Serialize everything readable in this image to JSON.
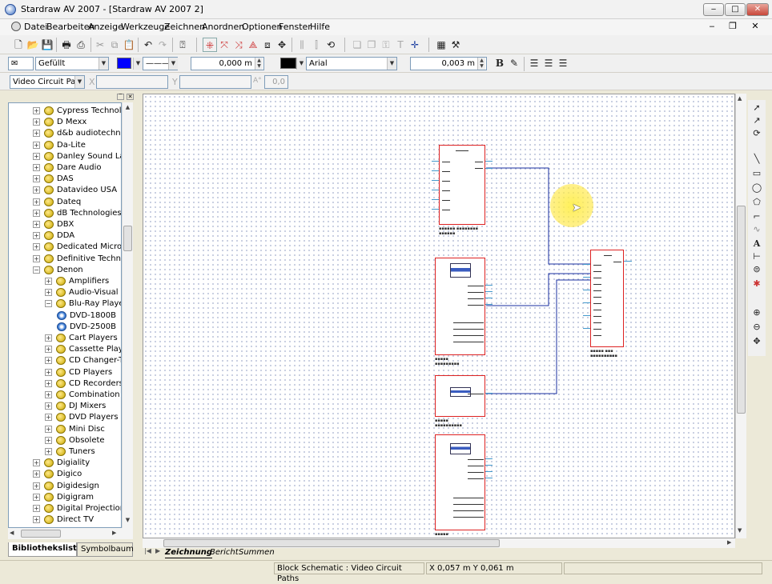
{
  "window": {
    "title": "Stardraw AV 2007 - [Stardraw AV 2007 2]",
    "min_label": "‒",
    "max_label": "□",
    "close_label": "✕"
  },
  "menu": [
    "Datei",
    "Bearbeiten",
    "Anzeige",
    "Werkzeuge",
    "Zeichnen",
    "Anordnen",
    "Optionen",
    "Fenster",
    "Hilfe"
  ],
  "mdi": {
    "min_label": "‒",
    "restore_label": "❐",
    "close_label": "✕"
  },
  "format_bar": {
    "fill_style": "Gefüllt",
    "line_width": "0,000 m",
    "font": "Arial",
    "font_size": "0,003 m",
    "bold_label": "B",
    "fill_color": "#0000ff",
    "text_color": "#000000"
  },
  "layer_bar": {
    "layer": "Video Circuit Paths",
    "x_label": "X",
    "x_value": "",
    "y_label": "Y",
    "y_value": "",
    "angle_label": "A°",
    "angle_value": "0,0"
  },
  "library": {
    "items": [
      {
        "label": "Cypress Technolog",
        "level": 0,
        "expanded": false
      },
      {
        "label": "D Mexx",
        "level": 0,
        "expanded": false
      },
      {
        "label": "d&b audiotechnik",
        "level": 0,
        "expanded": false
      },
      {
        "label": "Da-Lite",
        "level": 0,
        "expanded": false
      },
      {
        "label": "Danley Sound Labs",
        "level": 0,
        "expanded": false
      },
      {
        "label": "Dare Audio",
        "level": 0,
        "expanded": false
      },
      {
        "label": "DAS",
        "level": 0,
        "expanded": false
      },
      {
        "label": "Datavideo USA",
        "level": 0,
        "expanded": false
      },
      {
        "label": "Dateq",
        "level": 0,
        "expanded": false
      },
      {
        "label": "dB Technologies",
        "level": 0,
        "expanded": false
      },
      {
        "label": "DBX",
        "level": 0,
        "expanded": false
      },
      {
        "label": "DDA",
        "level": 0,
        "expanded": false
      },
      {
        "label": "Dedicated Micros",
        "level": 0,
        "expanded": false
      },
      {
        "label": "Definitive Technol",
        "level": 0,
        "expanded": false
      },
      {
        "label": "Denon",
        "level": 0,
        "expanded": true
      },
      {
        "label": "Amplifiers",
        "level": 1,
        "expanded": false
      },
      {
        "label": "Audio-Visual",
        "level": 1,
        "expanded": false
      },
      {
        "label": "Blu-Ray Players",
        "level": 1,
        "expanded": true
      },
      {
        "label": "DVD-1800B",
        "level": 2,
        "device": true
      },
      {
        "label": "DVD-2500B",
        "level": 2,
        "device": true
      },
      {
        "label": "Cart Players",
        "level": 1,
        "expanded": false
      },
      {
        "label": "Cassette Player",
        "level": 1,
        "expanded": false
      },
      {
        "label": "CD Changer-Tu",
        "level": 1,
        "expanded": false
      },
      {
        "label": "CD Players",
        "level": 1,
        "expanded": false
      },
      {
        "label": "CD Recorders",
        "level": 1,
        "expanded": false
      },
      {
        "label": "Combination P",
        "level": 1,
        "expanded": false
      },
      {
        "label": "DJ Mixers",
        "level": 1,
        "expanded": false
      },
      {
        "label": "DVD Players",
        "level": 1,
        "expanded": false
      },
      {
        "label": "Mini Disc",
        "level": 1,
        "expanded": false
      },
      {
        "label": "Obsolete",
        "level": 1,
        "expanded": false
      },
      {
        "label": "Tuners",
        "level": 1,
        "expanded": false
      },
      {
        "label": "Digiality",
        "level": 0,
        "expanded": false
      },
      {
        "label": "Digico",
        "level": 0,
        "expanded": false
      },
      {
        "label": "Digidesign",
        "level": 0,
        "expanded": false
      },
      {
        "label": "Digigram",
        "level": 0,
        "expanded": false
      },
      {
        "label": "Digital Projection",
        "level": 0,
        "expanded": false
      },
      {
        "label": "Direct TV",
        "level": 0,
        "expanded": false
      }
    ],
    "tabs": [
      "Bibliotheksliste",
      "Symbolbaum"
    ],
    "active_tab": "Bibliotheksliste"
  },
  "sheet_tabs": [
    "Zeichnung",
    "Bericht",
    "Summen"
  ],
  "active_sheet": "Zeichnung",
  "status": {
    "layer_info": "Block Schematic : Video Circuit Paths",
    "coords": "X 0,057 m Y 0,061 m"
  }
}
